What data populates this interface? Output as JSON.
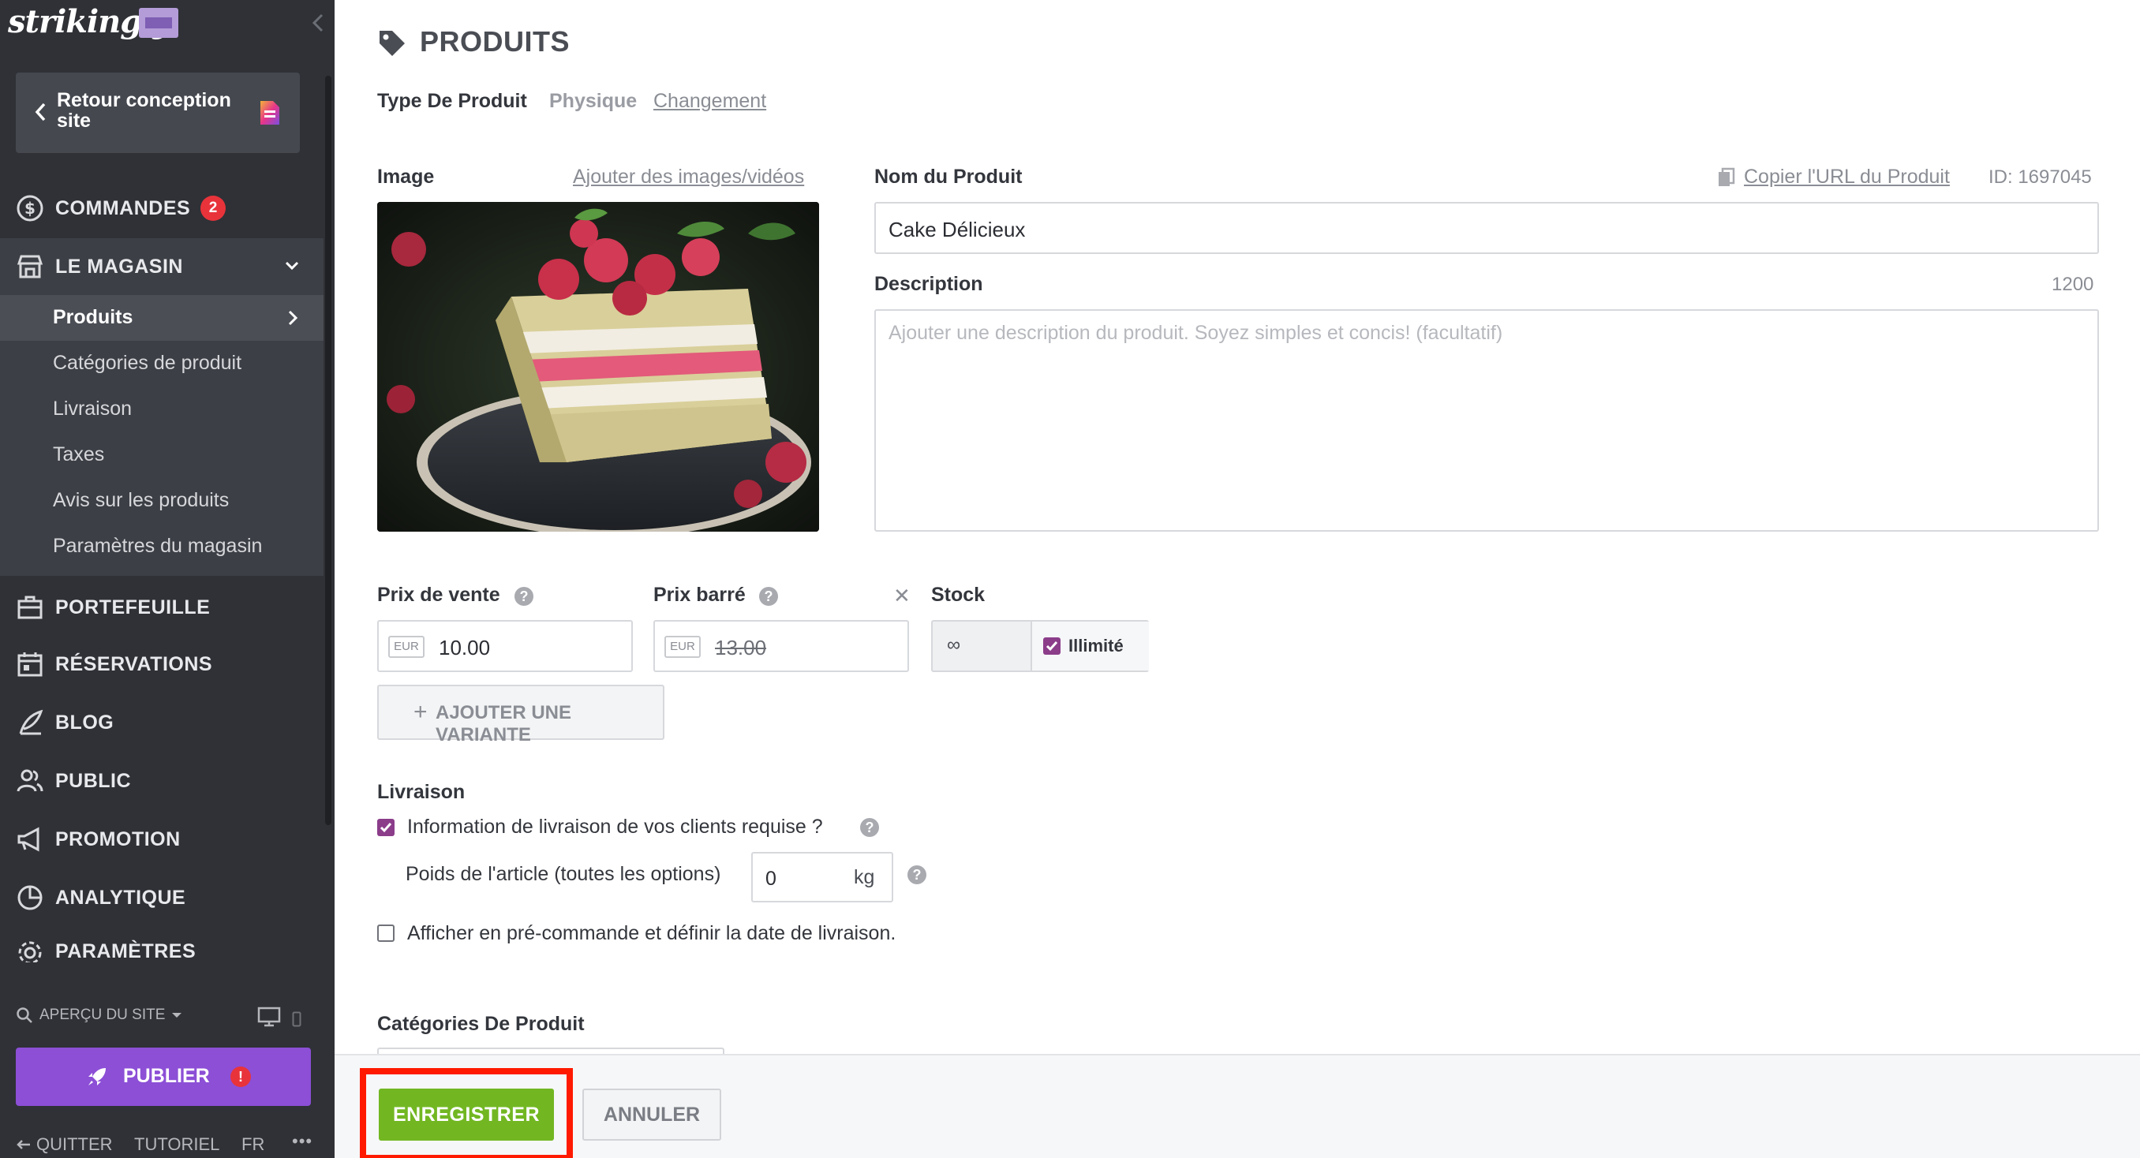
{
  "sidebar": {
    "logo": "strikingly",
    "back_button": "Retour conception site",
    "nav": {
      "orders": "COMMANDES",
      "orders_badge": "2",
      "store": "LE MAGASIN",
      "portfolio": "PORTEFEUILLE",
      "reservations": "RÉSERVATIONS",
      "blog": "BLOG",
      "public": "PUBLIC",
      "promotion": "PROMOTION",
      "analytics": "ANALYTIQUE",
      "settings": "PARAMÈTRES"
    },
    "store_sub": {
      "products": "Produits",
      "categories": "Catégories de produit",
      "shipping": "Livraison",
      "taxes": "Taxes",
      "reviews": "Avis sur les produits",
      "store_settings": "Paramètres du magasin"
    },
    "preview": "APERÇU DU SITE",
    "publish": "PUBLIER",
    "publish_alert": "!",
    "footer": {
      "quit": "QUITTER",
      "tutorial": "TUTORIEL",
      "lang": "FR",
      "more": "•••"
    }
  },
  "main": {
    "title": "PRODUITS",
    "product_type_label": "Type De Produit",
    "product_type_value": "Physique",
    "product_type_change": "Changement",
    "image_label": "Image",
    "add_media": "Ajouter des images/vidéos",
    "name_label": "Nom du Produit",
    "copy_url": "Copier l'URL du Produit",
    "product_id": "ID: 1697045",
    "name_value": "Cake Délicieux",
    "description_label": "Description",
    "description_counter": "1200",
    "description_placeholder": "Ajouter une description du produit. Soyez simples et concis! (facultatif)",
    "sale_price_label": "Prix de vente",
    "currency": "EUR",
    "sale_price_value": "10.00",
    "strike_price_label": "Prix barré",
    "strike_price_value": "13.00",
    "stock_label": "Stock",
    "stock_value": "∞",
    "unlimited_label": "Illimité",
    "add_variant": "AJOUTER UNE VARIANTE",
    "shipping_label": "Livraison",
    "shipping_required": "Information de livraison de vos clients requise ?",
    "weight_label": "Poids de l'article (toutes les options)",
    "weight_value": "0",
    "weight_unit": "kg",
    "preorder_label": "Afficher en pré-commande et définir la date de livraison.",
    "categories_label": "Catégories De Produit",
    "help_glyph": "?",
    "clear_glyph": "✕",
    "plus_glyph": "+"
  },
  "actions": {
    "save": "ENREGISTRER",
    "cancel": "ANNULER"
  },
  "colors": {
    "sidebar_bg": "#2f3136",
    "publish": "#8c4fd6",
    "save": "#72b722",
    "badge": "#e8333b",
    "checkbox": "#8b3d8a",
    "highlight": "#ff1a00"
  },
  "icons": [
    "logo-chip-icon",
    "chevron-left-icon",
    "document-icon",
    "dollar-circle-icon",
    "store-icon",
    "chevron-down-icon",
    "chevron-right-icon",
    "briefcase-icon",
    "calendar-icon",
    "feather-icon",
    "people-icon",
    "megaphone-icon",
    "pie-chart-icon",
    "gear-icon",
    "search-icon",
    "caret-down-icon",
    "desktop-icon",
    "mobile-icon",
    "rocket-icon",
    "arrow-left-icon",
    "tag-icon",
    "copy-icon",
    "help-icon",
    "close-icon",
    "plus-icon",
    "checkbox-checked-icon",
    "checkbox-empty-icon"
  ]
}
